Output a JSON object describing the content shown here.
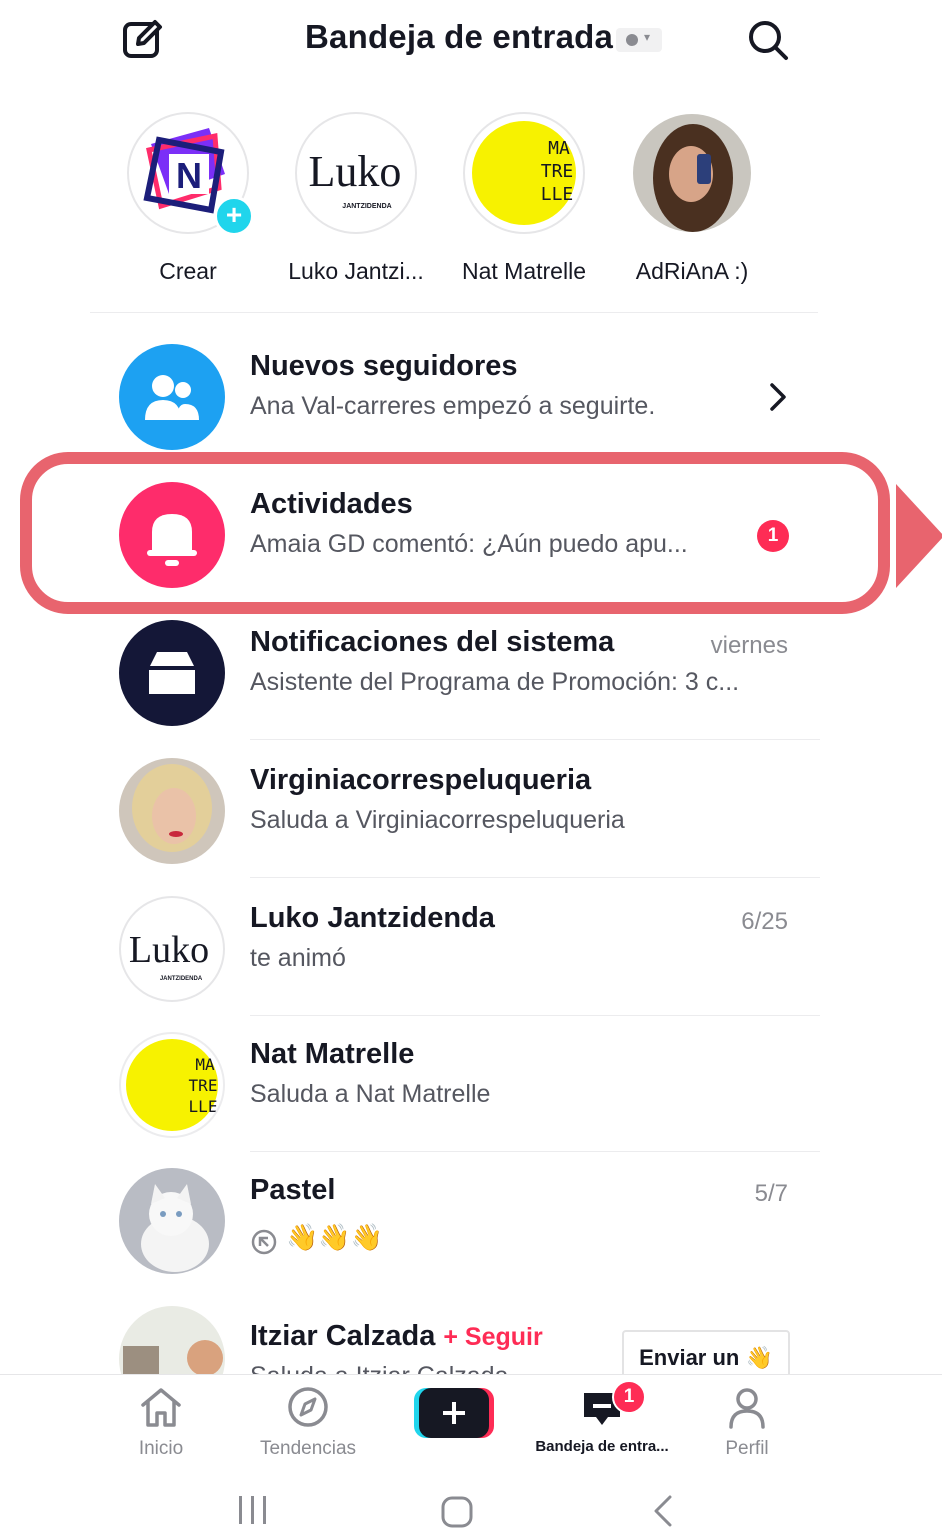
{
  "header": {
    "title": "Bandeja de entrada"
  },
  "stories": [
    {
      "name": "Crear"
    },
    {
      "name": "Luko Jantzi..."
    },
    {
      "name": "Nat Matrelle"
    },
    {
      "name": "AdRiAnA :)"
    }
  ],
  "logos": {
    "matrelle": [
      "MA",
      "TRE",
      "LLE"
    ],
    "luko": "Luko",
    "luko_sub": "JANTZIDENDA",
    "nnn": "N"
  },
  "rows": [
    {
      "title": "Nuevos seguidores",
      "subtitle": "Ana Val-carreres empezó a seguirte.",
      "date": ""
    },
    {
      "title": "Actividades",
      "subtitle": "Amaia GD comentó: ¿Aún puedo apu...",
      "badge": "1"
    },
    {
      "title": "Notificaciones del sistema",
      "subtitle": "Asistente del Programa de Promoción: 3 c...",
      "date": "viernes"
    },
    {
      "title": "Virginiacorrespeluqueria",
      "subtitle": "Saluda a Virginiacorrespeluqueria"
    },
    {
      "title": "Luko Jantzidenda",
      "subtitle": "te animó",
      "date": "6/25"
    },
    {
      "title": "Nat Matrelle",
      "subtitle": "Saluda a Nat Matrelle"
    },
    {
      "title": "Pastel",
      "subtitle": "👋👋👋",
      "date": "5/7"
    },
    {
      "title": "Itziar Calzada",
      "follow": "+ Seguir",
      "subtitle": "Saluda a Itziar Calzada",
      "send_label": "Enviar un 👋"
    }
  ],
  "nav": [
    {
      "label": "Inicio",
      "icon": "home-icon"
    },
    {
      "label": "Tendencias",
      "icon": "compass-icon"
    },
    {
      "label": "",
      "icon": "plus-icon"
    },
    {
      "label": "Bandeja de entra...",
      "icon": "inbox-icon",
      "badge": "1"
    },
    {
      "label": "Perfil",
      "icon": "profile-icon"
    }
  ],
  "colors": {
    "accent": "#fe2c55",
    "cyan": "#20d5ec",
    "highlight": "#e8646e",
    "followers": "#1da1f2",
    "activities": "#fe2c6b",
    "system": "#141737",
    "yellow": "#f7f200"
  }
}
